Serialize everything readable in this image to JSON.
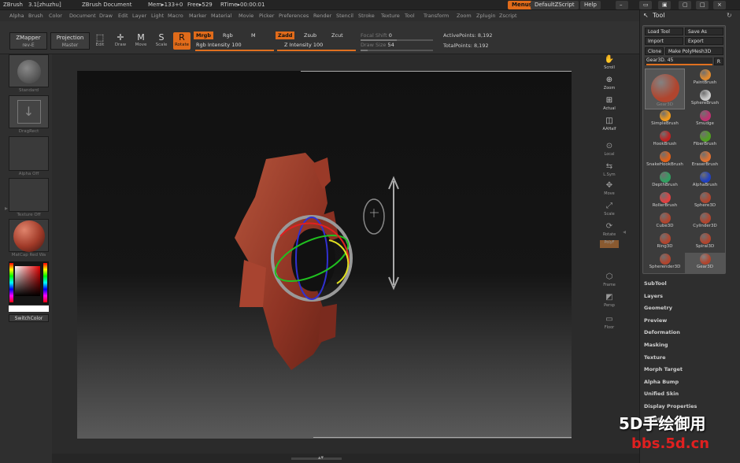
{
  "titlebar": {
    "app": "ZBrush",
    "version": "3.1[zhuzhu]",
    "document": "ZBrush Document",
    "mem": "Mem▸133+0",
    "free": "Free▸529",
    "rtime": "RTime▸00:00:01",
    "menus_btn": "Menus",
    "script_btn": "DefaultZScript",
    "help_btn": "Help"
  },
  "menubar": [
    "Alpha",
    "Brush",
    "Color",
    "Document",
    "Draw",
    "Edit",
    "Layer",
    "Light",
    "Macro",
    "Marker",
    "Material",
    "Movie",
    "Picker",
    "Preferences",
    "Render",
    "Stencil",
    "Stroke",
    "Texture",
    "Tool",
    "Transform",
    "Zoom",
    "Zplugin",
    "Zscript"
  ],
  "toolbar": {
    "zmapper": "ZMapper",
    "zmapper_sub": "rev-E",
    "projection": "Projection",
    "projection_sub": "Master",
    "edit": "Edit",
    "draw": "Draw",
    "move": "Move",
    "scale": "Scale",
    "rotate": "Rotate",
    "mrgb": "Mrgb",
    "rgb": "Rgb",
    "m": "M",
    "rgb_intensity_label": "Rgb Intensity",
    "rgb_intensity": "100",
    "zadd": "Zadd",
    "zsub": "Zsub",
    "zcut": "Zcut",
    "z_intensity_label": "Z Intensity",
    "z_intensity": "100",
    "focal_label": "Focal Shift",
    "focal": "0",
    "drawsize_label": "Draw Size",
    "drawsize": "54",
    "active_label": "ActivePoints:",
    "active": "8,192",
    "total_label": "TotalPoints:",
    "total": "8,192",
    "rgb_intensity_fill": 1.0,
    "z_intensity_fill": 1.0,
    "focal_fill": 0.5,
    "drawsize_fill": 0.1
  },
  "leftshelf": {
    "standard": "Standard",
    "dragrect": "DragRect",
    "alpha": "Alpha Off",
    "texture": "Texture Off",
    "matcap": "MatCap Red Wa",
    "switchcolor": "SwitchColor"
  },
  "rightshelf": [
    {
      "icon": "hand-icon",
      "label": "Scroll"
    },
    {
      "icon": "zoom-icon",
      "label": "Zoom"
    },
    {
      "icon": "actual-icon",
      "label": "Actual"
    },
    {
      "icon": "aahalf-icon",
      "label": "AAHalf"
    },
    {
      "icon": "local-icon",
      "label": "Local"
    },
    {
      "icon": "lsym-icon",
      "label": "L.Sym"
    },
    {
      "icon": "move-icon",
      "label": "Move"
    },
    {
      "icon": "scale-icon",
      "label": "Scale"
    },
    {
      "icon": "rotate-icon",
      "label": "Rotate"
    },
    {
      "icon": "polyf-icon",
      "label": "PolyF"
    },
    {
      "icon": "frame-icon",
      "label": "Frame"
    },
    {
      "icon": "persp-icon",
      "label": "Persp"
    },
    {
      "icon": "floor-icon",
      "label": "Floor"
    }
  ],
  "toolpanel": {
    "title": "Tool",
    "load": "Load Tool",
    "save": "Save As",
    "import": "Import",
    "export": "Export",
    "clone": "Clone",
    "make": "Make PolyMesh3D",
    "current": "Gear3D. 45",
    "r": "R",
    "brushes": [
      {
        "name": "Gear3D",
        "color": "#b0452e"
      },
      {
        "name": "PaintBrush",
        "color": "#e08a2e"
      },
      {
        "name": "SphereBrush",
        "color": "#cccccc"
      },
      {
        "name": "SimpleBrush",
        "color": "#f09a1a"
      },
      {
        "name": "Smudge",
        "color": "#c03070"
      },
      {
        "name": "HookBrush",
        "color": "#c02020"
      },
      {
        "name": "FiberBrush",
        "color": "#50a020"
      },
      {
        "name": "SnakeHookBrush",
        "color": "#e06018"
      },
      {
        "name": "EraserBrush",
        "color": "#e07030"
      },
      {
        "name": "DepthBrush",
        "color": "#30a060"
      },
      {
        "name": "AlphaBrush",
        "color": "#2040c0"
      },
      {
        "name": "RollerBrush",
        "color": "#e04040"
      },
      {
        "name": "Sphere3D",
        "color": "#b0452e"
      },
      {
        "name": "Cube3D",
        "color": "#b0452e"
      },
      {
        "name": "Cylinder3D",
        "color": "#b0452e"
      },
      {
        "name": "Ring3D",
        "color": "#b0452e"
      },
      {
        "name": "Spiral3D",
        "color": "#b0452e"
      },
      {
        "name": "Spherender3D",
        "color": "#b0452e"
      },
      {
        "name": "Gear3D",
        "color": "#b0452e"
      }
    ],
    "menu": [
      "SubTool",
      "Layers",
      "Geometry",
      "Preview",
      "Deformation",
      "Masking",
      "Texture",
      "Morph Target",
      "Alpha Bump",
      "Unified Skin",
      "Display Properties",
      "Export"
    ]
  },
  "watermark": {
    "line1": "5D手绘御用",
    "line2": "bbs.5d.cn"
  },
  "colors": {
    "accent": "#e06b1a",
    "model": "#9a3a28"
  }
}
